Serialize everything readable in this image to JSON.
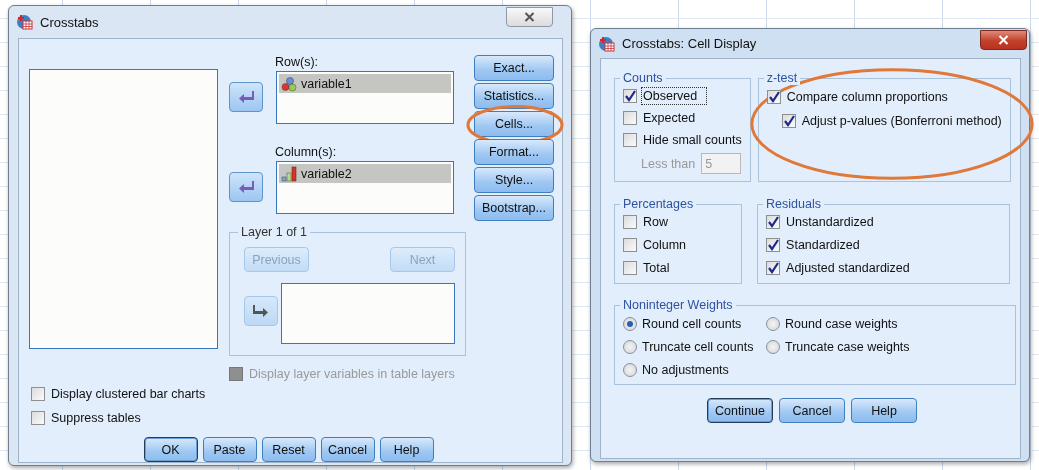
{
  "crosstabs": {
    "title": "Crosstabs",
    "rows_label": "Row(s):",
    "row_variables": [
      {
        "name": "variable1",
        "kind": "nominal",
        "selected": true
      }
    ],
    "columns_label": "Column(s):",
    "column_variables": [
      {
        "name": "variable2",
        "kind": "ordinal",
        "selected": true
      }
    ],
    "side_buttons": [
      {
        "label": "Exact...",
        "annotated": false
      },
      {
        "label": "Statistics...",
        "annotated": false
      },
      {
        "label": "Cells...",
        "annotated": true
      },
      {
        "label": "Format...",
        "annotated": false
      },
      {
        "label": "Style...",
        "annotated": false
      },
      {
        "label": "Bootstrap...",
        "annotated": false
      }
    ],
    "layer": {
      "title": "Layer 1 of 1",
      "previous": {
        "label": "Previous",
        "disabled": true
      },
      "next": {
        "label": "Next",
        "disabled": true
      }
    },
    "layer_option": {
      "label": "Display layer variables in table layers",
      "checked": false,
      "disabled": true
    },
    "options": [
      {
        "label": "Display clustered bar charts",
        "checked": false
      },
      {
        "label": "Suppress tables",
        "checked": false
      }
    ],
    "buttons": [
      {
        "label": "OK",
        "default": true
      },
      {
        "label": "Paste",
        "default": false
      },
      {
        "label": "Reset",
        "default": false
      },
      {
        "label": "Cancel",
        "default": false
      },
      {
        "label": "Help",
        "default": false
      }
    ]
  },
  "cell_display": {
    "title": "Crosstabs: Cell Display",
    "counts": {
      "title": "Counts",
      "items": [
        {
          "label": "Observed",
          "checked": true,
          "focused": true
        },
        {
          "label": "Expected",
          "checked": false,
          "focused": false
        },
        {
          "label": "Hide small counts",
          "checked": false,
          "focused": false
        }
      ],
      "less_than": {
        "label": "Less than",
        "value": "5",
        "disabled": true
      }
    },
    "z_test": {
      "title": "z-test",
      "annotated": true,
      "items": [
        {
          "label": "Compare column proportions",
          "checked": true,
          "children": [
            {
              "label": "Adjust p-values (Bonferroni method)",
              "checked": true
            }
          ]
        }
      ]
    },
    "percentages": {
      "title": "Percentages",
      "items": [
        {
          "label": "Row",
          "checked": false
        },
        {
          "label": "Column",
          "checked": false
        },
        {
          "label": "Total",
          "checked": false
        }
      ]
    },
    "residuals": {
      "title": "Residuals",
      "items": [
        {
          "label": "Unstandardized",
          "checked": true
        },
        {
          "label": "Standardized",
          "checked": true
        },
        {
          "label": "Adjusted standardized",
          "checked": true
        }
      ]
    },
    "weights": {
      "title": "Noninteger Weights",
      "options": [
        {
          "label": "Round cell counts",
          "selected": true
        },
        {
          "label": "Round case weights",
          "selected": false
        },
        {
          "label": "Truncate cell counts",
          "selected": false
        },
        {
          "label": "Truncate case weights",
          "selected": false
        },
        {
          "label": "No adjustments",
          "selected": false
        }
      ]
    },
    "buttons": [
      {
        "label": "Continue",
        "default": true
      },
      {
        "label": "Cancel",
        "default": false
      },
      {
        "label": "Help",
        "default": false
      }
    ]
  }
}
